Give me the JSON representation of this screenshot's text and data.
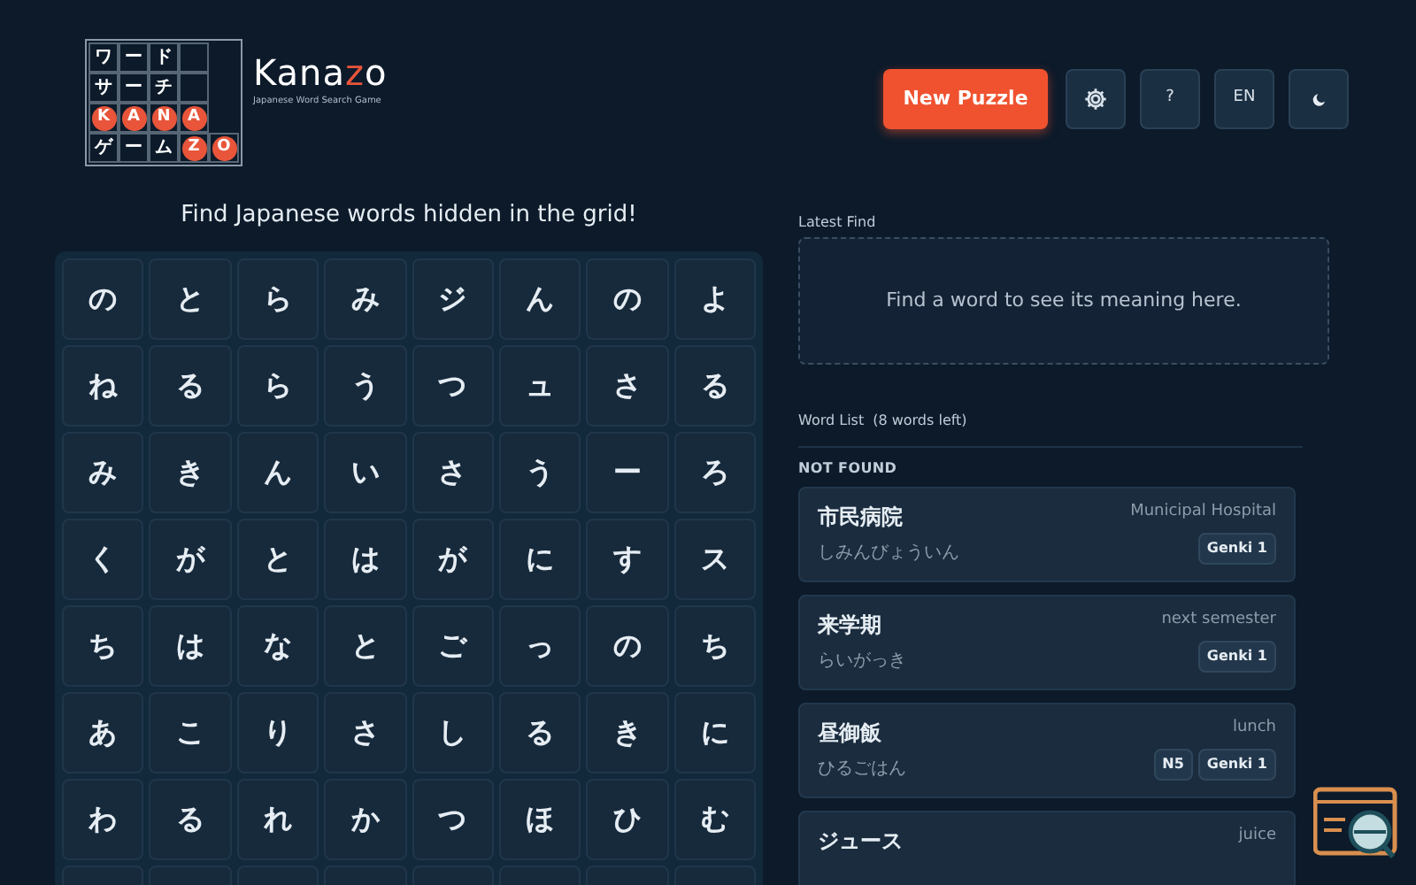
{
  "logo": {
    "rows": [
      [
        {
          "text": "ワ",
          "circled": false
        },
        {
          "text": "ー",
          "circled": false
        },
        {
          "text": "ド",
          "circled": false
        },
        {
          "circled": false
        }
      ],
      [
        {
          "text": "サ",
          "circled": false
        },
        {
          "text": "ー",
          "circled": false
        },
        {
          "text": "チ",
          "circled": false
        },
        {
          "circled": false
        }
      ],
      [
        {
          "text": "K",
          "circled": true
        },
        {
          "text": "A",
          "circled": true
        },
        {
          "text": "N",
          "circled": true
        },
        {
          "text": "A",
          "circled": true
        }
      ],
      [
        {
          "text": "ゲ",
          "circled": false
        },
        {
          "text": "ー",
          "circled": false
        },
        {
          "text": "ム",
          "circled": false
        },
        {
          "text": "Z",
          "circled": true
        },
        {
          "text": "O",
          "circled": true
        }
      ]
    ],
    "name_parts": [
      {
        "text": "Kana",
        "accent": false
      },
      {
        "text": "z",
        "accent": true
      },
      {
        "text": "o",
        "accent": false
      }
    ],
    "tagline": "Japanese Word Search Game"
  },
  "toolbar": [
    {
      "kind": "primary",
      "label": "New Puzzle"
    },
    {
      "kind": "gear"
    },
    {
      "kind": "text",
      "label": "?"
    },
    {
      "kind": "text",
      "label": "EN"
    },
    {
      "kind": "moon"
    }
  ],
  "instruction": "Find Japanese words hidden in the grid!",
  "grid": [
    [
      "の",
      "と",
      "ら",
      "み",
      "ジ",
      "ん",
      "の",
      "よ"
    ],
    [
      "ね",
      "る",
      "ら",
      "う",
      "つ",
      "ュ",
      "さ",
      "る"
    ],
    [
      "み",
      "き",
      "ん",
      "い",
      "さ",
      "う",
      "ー",
      "ろ"
    ],
    [
      "く",
      "が",
      "と",
      "は",
      "が",
      "に",
      "す",
      "ス"
    ],
    [
      "ち",
      "は",
      "な",
      "と",
      "ご",
      "っ",
      "の",
      "ち"
    ],
    [
      "あ",
      "こ",
      "り",
      "さ",
      "し",
      "る",
      "き",
      "に"
    ],
    [
      "わ",
      "る",
      "れ",
      "か",
      "つ",
      "ほ",
      "ひ",
      "む"
    ]
  ],
  "latest_find": {
    "heading": "Latest Find",
    "placeholder": "Find a word to see its meaning here."
  },
  "word_list": {
    "heading": "Word List",
    "count": "(8 words left)",
    "section": "NOT FOUND",
    "words": [
      {
        "word": "市民病院",
        "reading": "しみんびょういん",
        "meaning": "Municipal Hospital",
        "tags": [
          "Genki 1"
        ]
      },
      {
        "word": "来学期",
        "reading": "らいがっき",
        "meaning": "next semester",
        "tags": [
          "Genki 1"
        ]
      },
      {
        "word": "昼御飯",
        "reading": "ひるごはん",
        "meaning": "lunch",
        "tags": [
          "N5",
          "Genki 1"
        ]
      },
      {
        "word": "ジュース",
        "meaning": "juice"
      }
    ]
  }
}
